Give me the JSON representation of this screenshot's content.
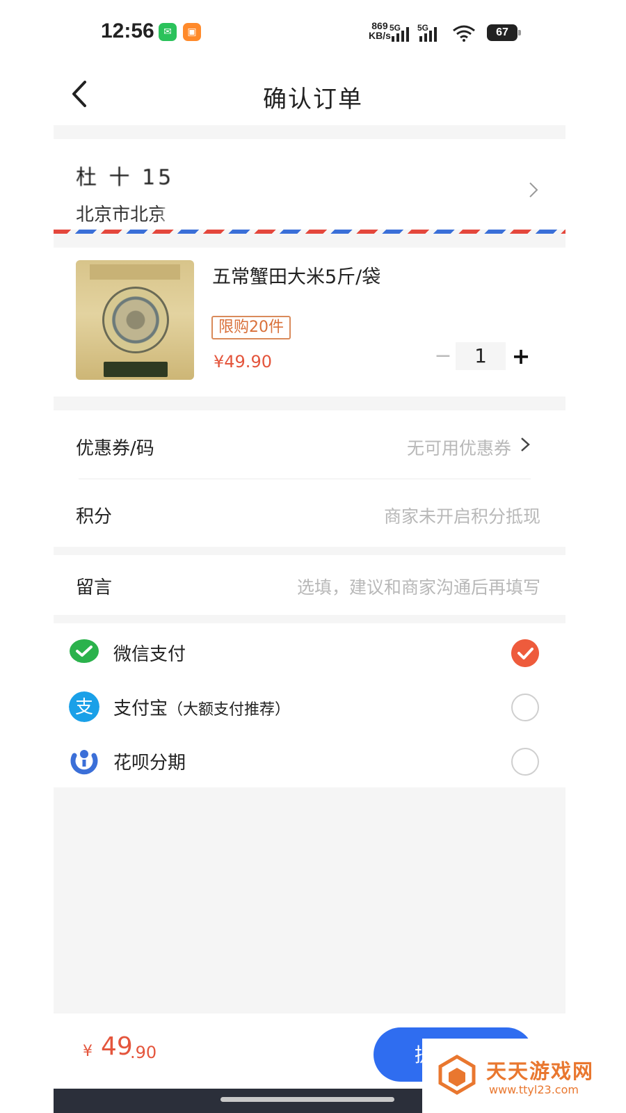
{
  "status_bar": {
    "time": "12:56",
    "net_speed_value": "869",
    "net_speed_unit": "KB/s",
    "signal_1": "5G",
    "signal_2": "5G",
    "battery": "67"
  },
  "header": {
    "title": "确认订单"
  },
  "address": {
    "name_line": "杜  十  15",
    "address_line": "北京市北京"
  },
  "product": {
    "title": "五常蟹田大米5斤/袋",
    "limit_badge": "限购20件",
    "price": "¥49.90",
    "quantity": "1",
    "minus_label": "−",
    "plus_label": "+"
  },
  "discounts": {
    "coupon_label": "优惠券/码",
    "coupon_value": "无可用优惠券",
    "points_label": "积分",
    "points_value": "商家未开启积分抵现"
  },
  "message": {
    "label": "留言",
    "placeholder": "选填，建议和商家沟通后再填写"
  },
  "payment": {
    "options": [
      {
        "label": "微信支付",
        "sub": "",
        "selected": true,
        "icon": "wechat-pay-icon",
        "color": "#2bb24c"
      },
      {
        "label": "支付宝",
        "sub": "（大额支付推荐）",
        "selected": false,
        "icon": "alipay-icon",
        "color": "#1aa0e8"
      },
      {
        "label": "花呗分期",
        "sub": "",
        "selected": false,
        "icon": "huabei-icon",
        "color": "#3b6fd8"
      }
    ]
  },
  "bottom": {
    "currency": "¥",
    "total_int": "49",
    "total_dec": ".90",
    "submit_label": "提交订单"
  },
  "watermark": {
    "text": "天天游戏网",
    "url": "www.ttyl23.com"
  },
  "colors": {
    "accent_price": "#e4553c",
    "primary_button": "#2f6df0",
    "check_selected": "#ee5b3c"
  }
}
